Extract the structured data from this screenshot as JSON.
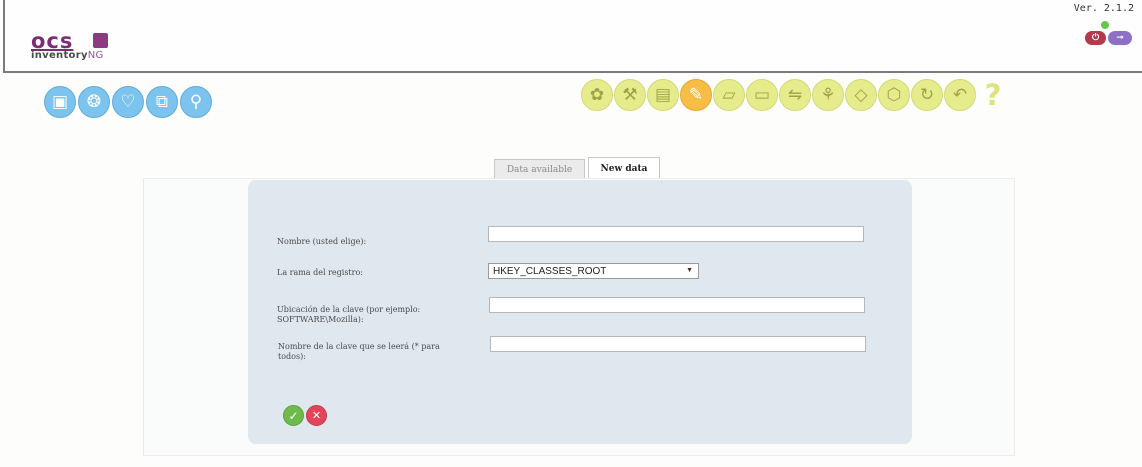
{
  "header": {
    "logo_text": "ocs",
    "logo_sub_a": "inventory",
    "logo_sub_b": "NG",
    "version": "Ver. 2.1.2",
    "colors": {
      "logo": "#7b2d73",
      "status": "#67c44c",
      "logout": "#b5394e",
      "key": "#8e6fc7"
    }
  },
  "left_icons": [
    {
      "name": "computers-icon",
      "glyph": "▣"
    },
    {
      "name": "network-icon",
      "glyph": "❂"
    },
    {
      "name": "heart-icon",
      "glyph": "♡"
    },
    {
      "name": "packages-icon",
      "glyph": "⧉"
    },
    {
      "name": "search-icon",
      "glyph": "⚲"
    }
  ],
  "right_icons": [
    {
      "name": "gift-icon",
      "glyph": "✿",
      "active": false
    },
    {
      "name": "wrench-icon",
      "glyph": "⚒",
      "active": false
    },
    {
      "name": "calendar-icon",
      "glyph": "▤",
      "active": false
    },
    {
      "name": "registry-icon",
      "glyph": "✎",
      "active": true
    },
    {
      "name": "document-icon",
      "glyph": "▱",
      "active": false
    },
    {
      "name": "folder-icon",
      "glyph": "▭",
      "active": false
    },
    {
      "name": "network-cable-icon",
      "glyph": "⇋",
      "active": false
    },
    {
      "name": "hierarchy-icon",
      "glyph": "⚘",
      "active": false
    },
    {
      "name": "tag-icon",
      "glyph": "◇",
      "active": false
    },
    {
      "name": "box-icon",
      "glyph": "⬡",
      "active": false
    },
    {
      "name": "refresh-icon",
      "glyph": "↻",
      "active": false
    },
    {
      "name": "back-icon",
      "glyph": "↶",
      "active": false
    },
    {
      "name": "help-icon",
      "glyph": "?",
      "active": false
    }
  ],
  "tabs": [
    {
      "label": "Data available",
      "active": false
    },
    {
      "label": "New data",
      "active": true
    }
  ],
  "form": {
    "name_label": "Nombre (usted elige):",
    "name_value": "",
    "branch_label": "La rama del registro:",
    "branch_selected": "HKEY_CLASSES_ROOT",
    "location_label_1": "Ubicación de la clave (por ejemplo:",
    "location_label_2": "SOFTWARE\\Mozilla):",
    "location_value": "",
    "key_name_label_1": "Nombre de la clave que se leerá (* para",
    "key_name_label_2": "todos):",
    "key_name_value": ""
  },
  "actions": {
    "ok_glyph": "✓",
    "cancel_glyph": "✕"
  }
}
